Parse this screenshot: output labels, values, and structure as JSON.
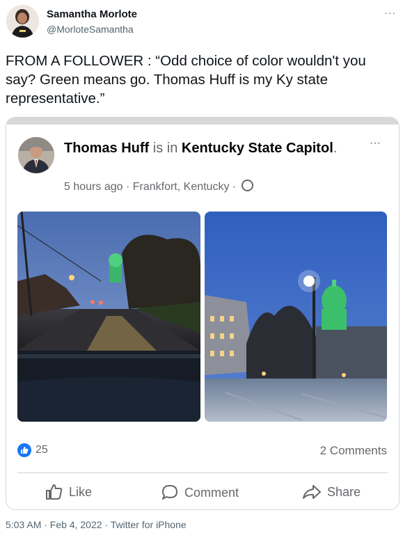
{
  "tweet": {
    "author_name": "Samantha Morlote",
    "author_handle": "@MorloteSamantha",
    "more_label": "···",
    "text": "FROM A FOLLOWER : “Odd choice of color wouldn't you say? Green means go. Thomas Huff is my Ky state representative.”",
    "timestamp": "5:03 AM · Feb 4, 2022 · Twitter for iPhone"
  },
  "fb_post": {
    "author": "Thomas Huff",
    "is_in": "is in",
    "place": "Kentucky State Capitol",
    "period": ".",
    "more_label": "···",
    "time": "5 hours ago",
    "location": "Frankfort, Kentucky",
    "sep": " · ",
    "likes_count": "25",
    "comments_label": "2 Comments",
    "actions": {
      "like": "Like",
      "comment": "Comment",
      "share": "Share"
    }
  },
  "colors": {
    "fb_blue": "#1877f2",
    "capitol_green": "#3bbf6a"
  }
}
